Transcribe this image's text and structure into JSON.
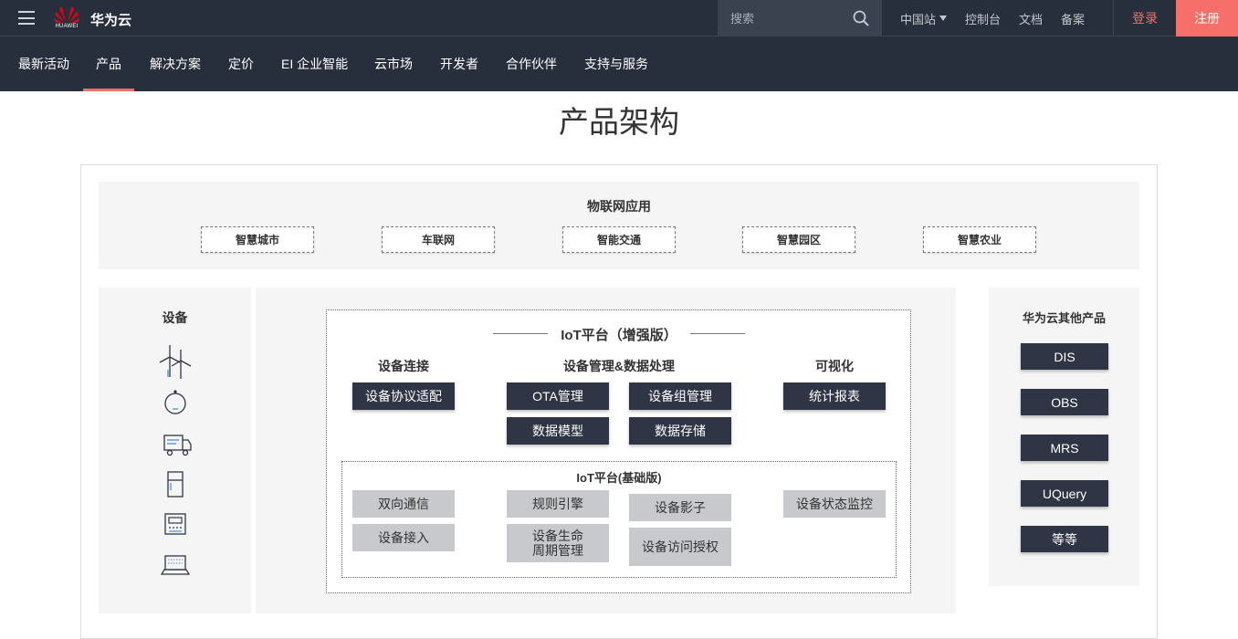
{
  "brand": {
    "logo_text": "HUAWEI",
    "name": "华为云"
  },
  "search": {
    "placeholder": "搜索"
  },
  "top_links": {
    "region": "中国站",
    "console": "控制台",
    "docs": "文档",
    "filing": "备案",
    "login": "登录",
    "register": "注册"
  },
  "nav": [
    "最新活动",
    "产品",
    "解决方案",
    "定价",
    "EI 企业智能",
    "云市场",
    "开发者",
    "合作伙伴",
    "支持与服务"
  ],
  "page_title": "产品架构",
  "iot_apps": {
    "title": "物联网应用",
    "items": [
      "智慧城市",
      "车联网",
      "智能交通",
      "智慧园区",
      "智慧农业"
    ]
  },
  "devices": {
    "title": "设备",
    "icons": [
      "wind-turbine-icon",
      "round-sensor-icon",
      "truck-icon",
      "refrigerator-icon",
      "meter-icon",
      "laptop-icon"
    ]
  },
  "platform_enhanced": {
    "title": "IoT平台（增强版）",
    "col_connect": "设备连接",
    "col_manage": "设备管理&数据处理",
    "col_visual": "可视化",
    "connect": [
      "设备协议适配"
    ],
    "manage": [
      "OTA管理",
      "设备组管理",
      "数据模型",
      "数据存储"
    ],
    "visual": [
      "统计报表"
    ]
  },
  "platform_basic": {
    "title": "IoT平台(基础版)",
    "items": [
      "双向通信",
      "设备接入",
      "规则引擎",
      "设备生命",
      "周期管理",
      "设备影子",
      "设备访问授权",
      "设备状态监控"
    ]
  },
  "other_products": {
    "title": "华为云其他产品",
    "items": [
      "DIS",
      "OBS",
      "MRS",
      "UQuery",
      "等等"
    ]
  },
  "colors": {
    "topbar": "#272e3c",
    "accent": "#f66f6a",
    "dark_box": "#2f3545",
    "light_box": "#c8c9cd"
  }
}
